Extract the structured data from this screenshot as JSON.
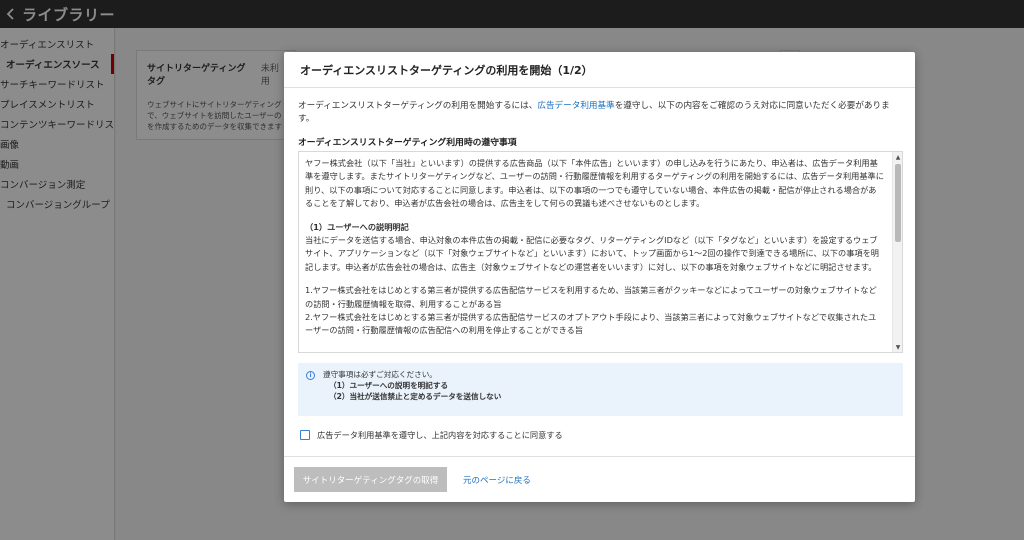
{
  "header": {
    "back_icon": "chevron-left-icon",
    "title": "ライブラリー"
  },
  "sidebar": {
    "items": [
      {
        "label": "オーディエンスリスト"
      },
      {
        "label": "オーディエンスソース"
      },
      {
        "label": "サーチキーワードリスト"
      },
      {
        "label": "プレイスメントリスト"
      },
      {
        "label": "コンテンツキーワードリスト"
      },
      {
        "label": "画像"
      },
      {
        "label": "動画"
      },
      {
        "label": "コンバージョン測定"
      },
      {
        "label": "コンバージョングループ"
      }
    ],
    "active_color": "#cc0000"
  },
  "background": {
    "card_title": "サイトリターゲティングタグ",
    "card_status": "未利用",
    "card_desc": [
      "ウェブサイトにサイトリターゲティング",
      "で、ウェブサイトを訪問したユーザーの",
      "を作成するためのデータを収集できます"
    ]
  },
  "modal": {
    "title": "オーディエンスリストターゲティングの利用を開始（1/2）",
    "intro_before": "オーディエンスリストターゲティングの利用を開始するには、",
    "intro_link": "広告データ利用基準",
    "intro_after": "を遵守し、以下の内容をご確認のうえ対応に同意いただく必要があります。",
    "section_title": "オーディエンスリストターゲティング利用時の遵守事項",
    "terms": {
      "p1": "ヤフー株式会社（以下「当社」といいます）の提供する広告商品（以下「本件広告」といいます）の申し込みを行うにあたり、申込者は、広告データ利用基準を遵守します。またサイトリターゲティングなど、ユーザーの訪問・行動履歴情報を利用するターゲティングの利用を開始するには、広告データ利用基準に則り、以下の事項について対応することに同意します。申込者は、以下の事項の一つでも遵守していない場合、本件広告の掲載・配信が停止される場合があることを了解しており、申込者が広告会社の場合は、広告主をして何らの異議も述べさせないものとします。",
      "h1": "（1）ユーザーへの説明明記",
      "p2": "当社にデータを送信する場合、申込対象の本件広告の掲載・配信に必要なタグ、リターゲティングIDなど（以下「タグなど」といいます）を設定するウェブサイト、アプリケーションなど（以下「対象ウェブサイトなど」といいます）において、トップ画面から1〜2回の操作で到達できる場所に、以下の事項を明記します。申込者が広告会社の場合は、広告主（対象ウェブサイトなどの運営者をいいます）に対し、以下の事項を対象ウェブサイトなどに明記させます。",
      "item1": "1.ヤフー株式会社をはじめとする第三者が提供する広告配信サービスを利用するため、当該第三者がクッキーなどによってユーザーの対象ウェブサイトなどの訪問・行動履歴情報を取得、利用することがある旨",
      "item2": "2.ヤフー株式会社をはじめとする第三者が提供する広告配信サービスのオプトアウト手段により、当該第三者によって対象ウェブサイトなどで収集されたユーザーの訪問・行動履歴情報の広告配信への利用を停止することができる旨"
    },
    "notice": {
      "line1": "遵守事項は必ずご対応ください。",
      "line2": "（1）ユーザーへの説明を明記する",
      "line3": "（2）当社が送信禁止と定めるデータを送信しない"
    },
    "agree_label": "広告データ利用基準を遵守し、上記内容を対応することに同意する",
    "primary_button": "サイトリターゲティングタグの取得",
    "back_link": "元のページに戻る",
    "link_color": "#1a6fc0"
  }
}
